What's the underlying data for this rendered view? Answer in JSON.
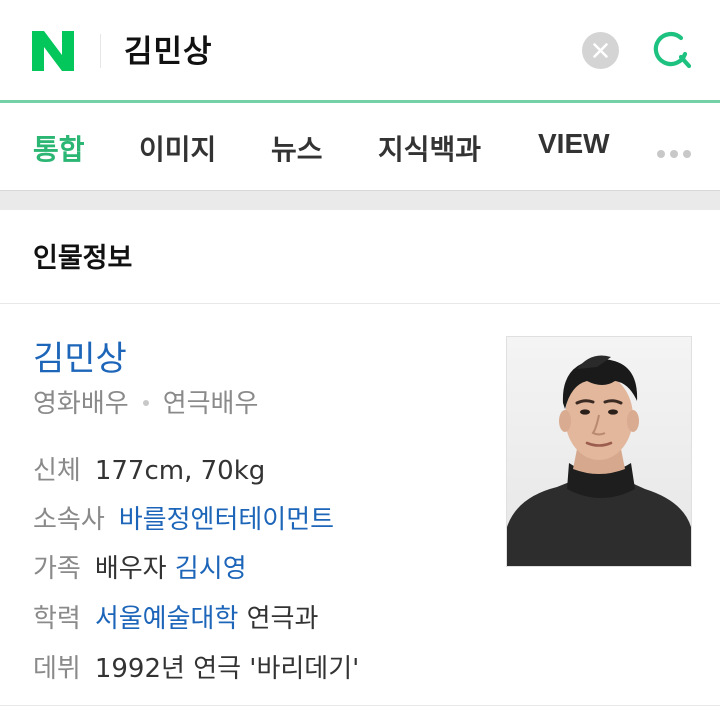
{
  "header": {
    "query": "김민상"
  },
  "tabs": [
    {
      "label": "통합"
    },
    {
      "label": "이미지"
    },
    {
      "label": "뉴스"
    },
    {
      "label": "지식백과"
    },
    {
      "label": "VIEW"
    }
  ],
  "colors": {
    "brand_green": "#03c75a",
    "active_tab": "#2bb673",
    "link_blue": "#1c65b9"
  },
  "card": {
    "section_title": "인물정보",
    "name": "김민상",
    "jobs": [
      "영화배우",
      "연극배우"
    ],
    "rows": {
      "body_label": "신체",
      "body_value": "177cm, 70kg",
      "agency_label": "소속사",
      "agency_value": "바를정엔터테이먼트",
      "family_label": "가족",
      "family_relation": "배우자",
      "family_name": "김시영",
      "edu_label": "학력",
      "edu_school": "서울예술대학",
      "edu_major": "연극과",
      "debut_label": "데뷔",
      "debut_value": "1992년 연극 '바리데기'"
    }
  }
}
